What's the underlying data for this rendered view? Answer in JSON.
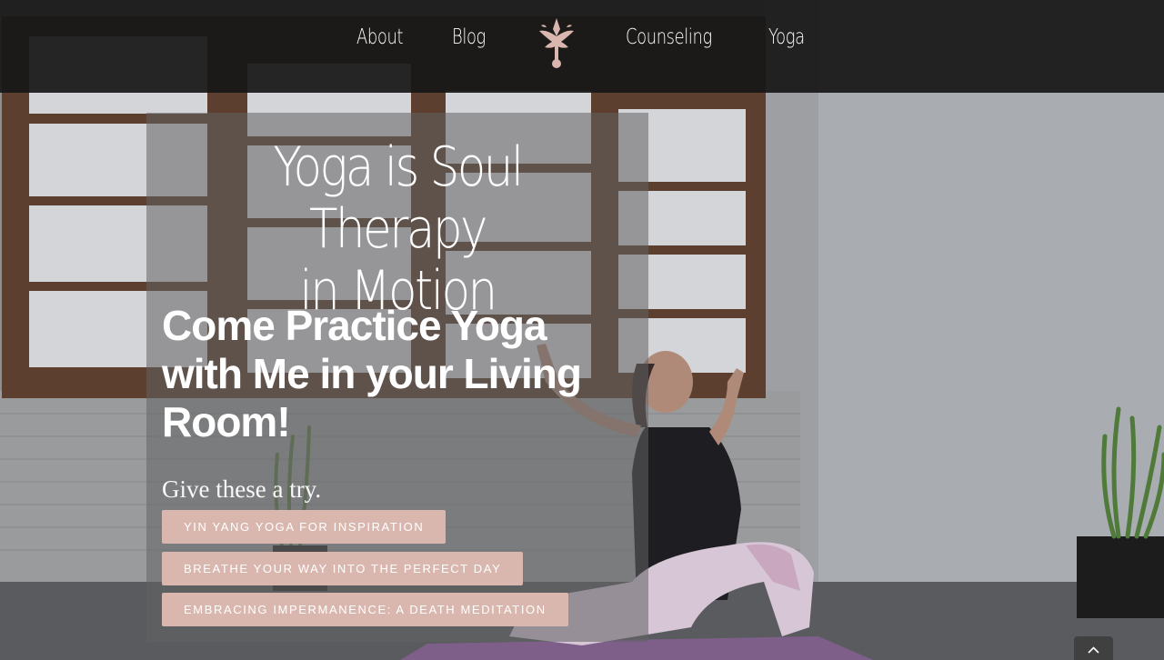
{
  "nav": {
    "items": [
      {
        "label": "About"
      },
      {
        "label": "Blog"
      },
      {
        "label": "Counseling"
      },
      {
        "label": "Yoga"
      }
    ],
    "logo_icon": "lotus-logo-icon",
    "accent_color": "#d9b7ae"
  },
  "hero": {
    "headline_line1": "Yoga is Soul Therapy",
    "headline_line2": "in Motion",
    "subhead_line1": "Come Practice Yoga",
    "subhead_line2": "with Me in your Living",
    "subhead_line3": "Room!",
    "try_text": "Give these a try.",
    "buttons": [
      {
        "label": "Yin Yang Yoga for Inspiration"
      },
      {
        "label": "Breathe Your Way into the Perfect Day"
      },
      {
        "label": "Embracing Impermanence: A Death Meditation"
      }
    ],
    "button_color": "#d9b7ae"
  },
  "scroll_to_top_icon": "chevron-up-icon"
}
